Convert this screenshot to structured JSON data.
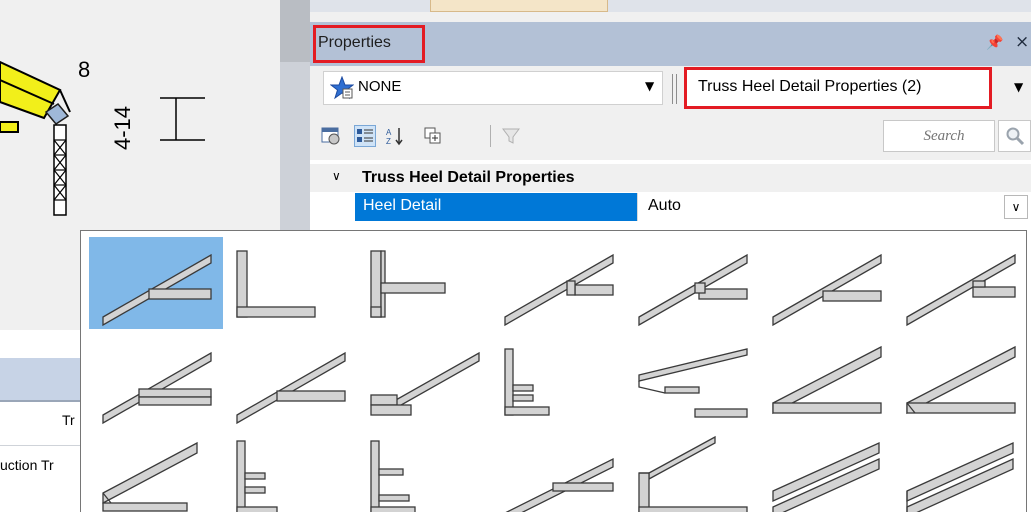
{
  "canvas": {
    "pitch_label": "8",
    "height_label": "4-14"
  },
  "lower_dock": {
    "column_label": "Tr",
    "row_label": "uction Tr"
  },
  "properties_panel": {
    "title": "Properties",
    "pin_icon": "pin-icon",
    "close_icon": "close-icon",
    "filter": {
      "value": "NONE",
      "icon": "star-filter-icon"
    },
    "type_selector": {
      "value": "Truss Heel Detail Properties (2)"
    },
    "toolbar": {
      "buttons": [
        "view-icon",
        "categorized-icon",
        "sort-az-icon",
        "expand-icon",
        "filter-funnel-icon"
      ],
      "search_placeholder": "Search",
      "search_icon": "magnifier-icon"
    },
    "grid": {
      "category": "Truss Heel Detail Properties",
      "property_name": "Heel Detail",
      "property_value": "Auto"
    }
  },
  "heel_detail_flyout": {
    "selected_index": 0,
    "option_count": 21
  },
  "colors": {
    "title_bar": "#b3c1d6",
    "highlight": "#e31b23",
    "selection": "#0078d7",
    "selected_tile": "#80b8e8",
    "truss_yellow": "#f2ef1a",
    "member_fill": "#d3d3d3"
  }
}
